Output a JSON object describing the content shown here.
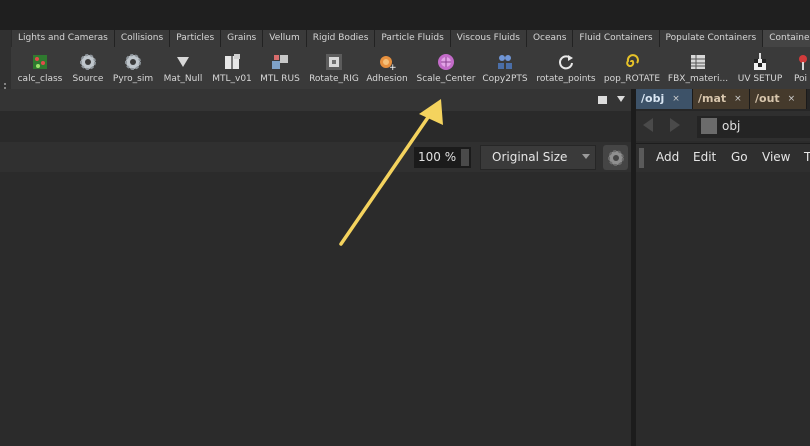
{
  "shelf_tabs": [
    "Lights and Cameras",
    "Collisions",
    "Particles",
    "Grains",
    "Vellum",
    "Rigid Bodies",
    "Particle Fluids",
    "Viscous Fluids",
    "Oceans",
    "Fluid Containers",
    "Populate Containers",
    "Container T"
  ],
  "tools": [
    {
      "label": "calc_class",
      "icon": "dots-green-cube-icon"
    },
    {
      "label": "Source",
      "icon": "gear-icon"
    },
    {
      "label": "Pyro_sim",
      "icon": "gear-icon"
    },
    {
      "label": "Mat_Null",
      "icon": "triangle-down-icon"
    },
    {
      "label": "MTL_v01",
      "icon": "book-icon"
    },
    {
      "label": "MTL RUS",
      "icon": "cubes-icon"
    },
    {
      "label": "Rotate_RIG",
      "icon": "rig-icon"
    },
    {
      "label": "Adhesion",
      "icon": "sphere-plus-icon"
    },
    {
      "label": "Scale_Center",
      "icon": "pink-sphere-icon"
    },
    {
      "label": "Copy2PTS",
      "icon": "people-icon"
    },
    {
      "label": "rotate_points",
      "icon": "refresh-icon"
    },
    {
      "label": "pop_ROTATE",
      "icon": "spiral-icon"
    },
    {
      "label": "FBX_materi...",
      "icon": "table-icon"
    },
    {
      "label": "UV SETUP",
      "icon": "checker-icon"
    },
    {
      "label": "Poi",
      "icon": "red-pin-icon"
    }
  ],
  "right_tabs": [
    {
      "label": "/obj",
      "close": "×"
    },
    {
      "label": "/mat",
      "close": "×"
    },
    {
      "label": "/out",
      "close": "×"
    }
  ],
  "viewer": {
    "zoom": "100 %",
    "size_option": "Original Size"
  },
  "network": {
    "path": "obj",
    "menu": [
      "Add",
      "Edit",
      "Go",
      "View",
      "T"
    ]
  },
  "colors": {
    "accent_obj_tab": "#3d5268",
    "annotation_arrow": "#f4d35e"
  }
}
